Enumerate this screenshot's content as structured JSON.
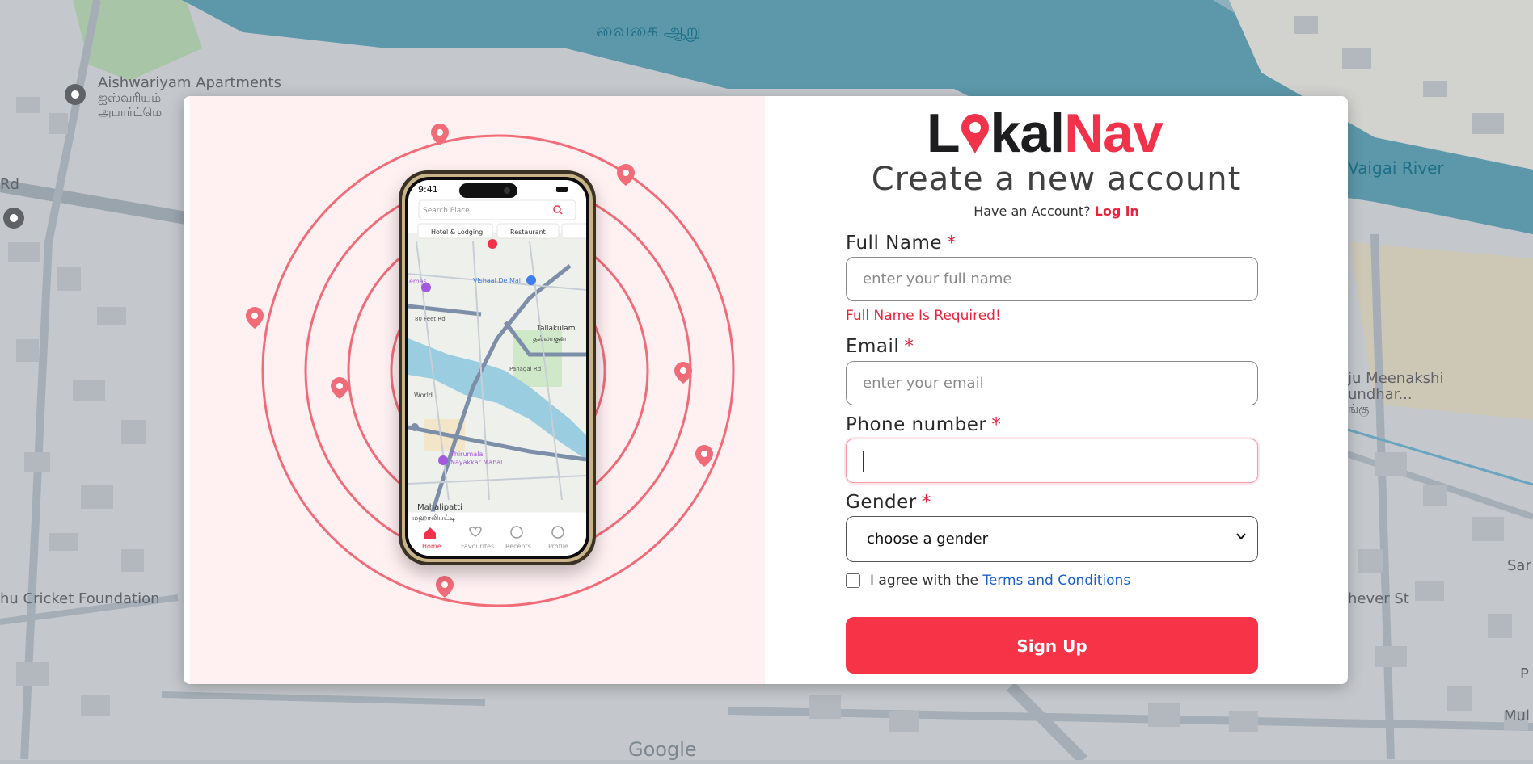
{
  "map": {
    "labels": {
      "river_tamil": "வைகை ஆறு",
      "apartments": "Aishwariyam Apartments",
      "apartments_tamil_1": "ஐஸ்வரியம்",
      "apartments_tamil_2": "அபார்ட்மெ",
      "rd": "Rd",
      "vaigai_river": "Vaigai River",
      "meenakshi_1": "ju Meenakshi",
      "meenakshi_2": "undhar...",
      "meenakshi_3": "ங்கு",
      "cricket": "hu Cricket Foundation",
      "sar": "Sar",
      "hever": "hever St",
      "p": "P",
      "mul": "Mul"
    },
    "google_logo": "Google"
  },
  "phone": {
    "time": "9:41",
    "search_placeholder": "Search Place",
    "chips": [
      "Hotel & Lodging",
      "Restaurant"
    ],
    "map_labels": {
      "vishaal": "Vishaal De Mal",
      "tallakulam": "Tallakulam",
      "tallakulam_ta": "தல்லாகுள",
      "mahalipatti": "Mahalipatti",
      "mahalipatti_ta": "மஹாலிபட்டி",
      "ft_rd": "80 Feet Rd",
      "tirumalai": "Thirumalai",
      "nayakkar": "Nayakkar Mahal",
      "emas": "emas",
      "world": "World",
      "panagal": "Panagal Rd"
    },
    "nav": [
      "Home",
      "Favourites",
      "Recents",
      "Profile"
    ]
  },
  "brand": {
    "part1": "L",
    "part2": "kal",
    "part3": "Nav"
  },
  "form": {
    "title": "Create a new account",
    "have_account": "Have an Account?",
    "login_link": "Log in",
    "required_mark": "*",
    "full_name": {
      "label": "Full Name",
      "placeholder": "enter your full name",
      "value": "",
      "error": "Full Name Is Required!"
    },
    "email": {
      "label": "Email",
      "placeholder": "enter your email",
      "value": ""
    },
    "phone": {
      "label": "Phone number",
      "placeholder": "",
      "value": ""
    },
    "gender": {
      "label": "Gender",
      "selected": "choose a gender"
    },
    "terms_prefix": "I agree with the",
    "terms_link": "Terms and Conditions",
    "terms_checked": false,
    "submit": "Sign Up"
  },
  "colors": {
    "brand_red": "#f0334a",
    "button_red": "#f73347",
    "left_bg": "#fff0f1",
    "ring": "#f26b78"
  }
}
